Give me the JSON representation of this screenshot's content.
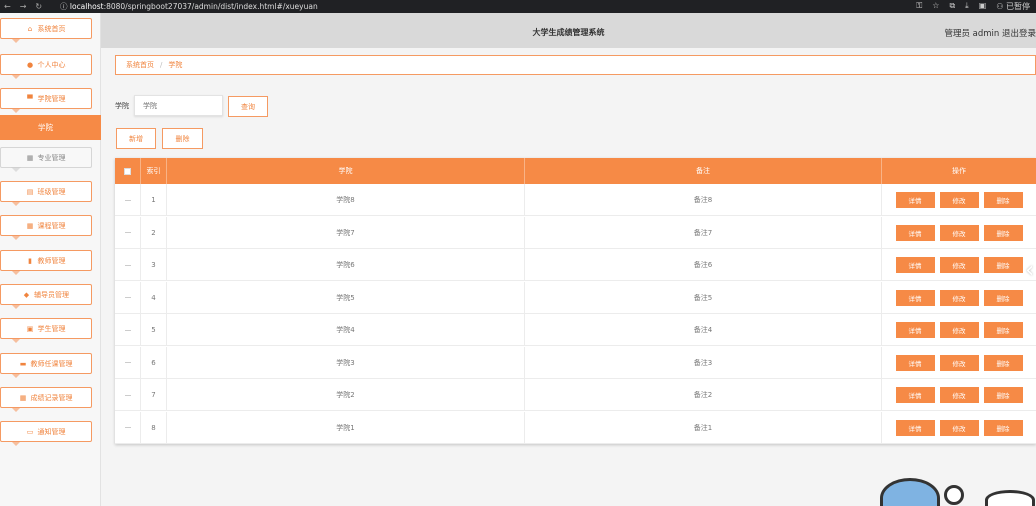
{
  "browser": {
    "url_host": "localhost",
    "url_rest": ":8080/springboot27037/admin/dist/index.html#/xueyuan",
    "profile": "已暂停"
  },
  "header": {
    "title": "大学生成绩管理系统",
    "user": "管理员 admin  退出登录"
  },
  "sidebar": {
    "items": [
      {
        "label": "系统首页",
        "icon": "home-icon"
      },
      {
        "label": "个人中心",
        "icon": "user-icon"
      },
      {
        "label": "学院管理",
        "icon": "building-icon"
      },
      {
        "label": "专业管理",
        "icon": "grid-icon"
      },
      {
        "label": "班级管理",
        "icon": "calendar-icon"
      },
      {
        "label": "课程管理",
        "icon": "grid-icon"
      },
      {
        "label": "教师管理",
        "icon": "bar-chart-icon"
      },
      {
        "label": "辅导员管理",
        "icon": "location-icon"
      },
      {
        "label": "学生管理",
        "icon": "id-card-icon"
      },
      {
        "label": "教师任课管理",
        "icon": "briefcase-icon"
      },
      {
        "label": "成绩记录管理",
        "icon": "grid-icon"
      },
      {
        "label": "通知管理",
        "icon": "message-icon"
      }
    ],
    "active_label": "学院"
  },
  "breadcrumb": {
    "home": "系统首页",
    "separator": "/",
    "current": "学院"
  },
  "search": {
    "label": "学院",
    "placeholder": "学院",
    "button": "查询"
  },
  "actions": {
    "add": "新增",
    "delete": "删除"
  },
  "table": {
    "headers": {
      "index": "索引",
      "college": "学院",
      "remark": "备注",
      "ops": "操作"
    },
    "rows": [
      {
        "index": "1",
        "college": "学院8",
        "remark": "备注8"
      },
      {
        "index": "2",
        "college": "学院7",
        "remark": "备注7"
      },
      {
        "index": "3",
        "college": "学院6",
        "remark": "备注6"
      },
      {
        "index": "4",
        "college": "学院5",
        "remark": "备注5"
      },
      {
        "index": "5",
        "college": "学院4",
        "remark": "备注4"
      },
      {
        "index": "6",
        "college": "学院3",
        "remark": "备注3"
      },
      {
        "index": "7",
        "college": "学院2",
        "remark": "备注2"
      },
      {
        "index": "8",
        "college": "学院1",
        "remark": "备注1"
      }
    ],
    "row_ops": {
      "detail": "详情",
      "edit": "修改",
      "delete": "删除"
    }
  },
  "colors": {
    "accent": "#f68a46",
    "border_accent": "#f59a62"
  }
}
